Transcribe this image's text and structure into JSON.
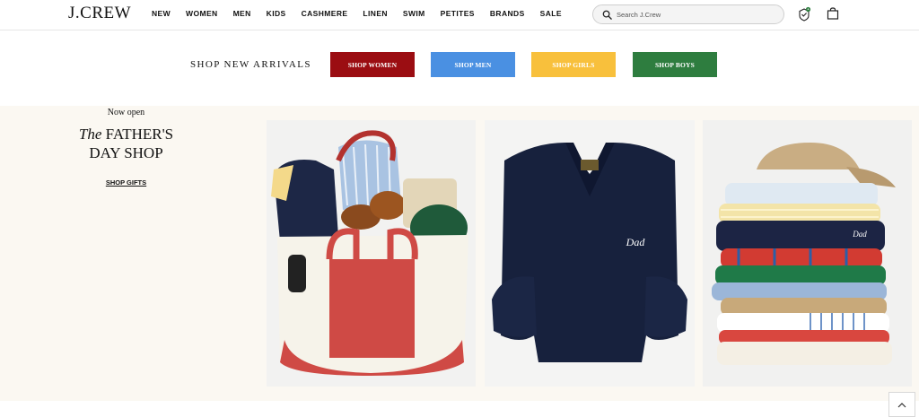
{
  "brand": {
    "logo": "J.CREW"
  },
  "nav": {
    "items": [
      "NEW",
      "WOMEN",
      "MEN",
      "KIDS",
      "CASHMERE",
      "LINEN",
      "SWIM",
      "PETITES",
      "BRANDS",
      "SALE"
    ]
  },
  "search": {
    "placeholder": "Search J.Crew"
  },
  "icons": {
    "rewards": "rewards-badge-icon",
    "bag": "shopping-bag-icon",
    "search": "magnifier-icon",
    "scroll_top": "chevron-up-icon"
  },
  "arrivals": {
    "label": "SHOP NEW ARRIVALS",
    "buttons": [
      {
        "label": "SHOP WOMEN",
        "color": "#9b0d12"
      },
      {
        "label": "SHOP MEN",
        "color": "#4a90e2"
      },
      {
        "label": "SHOP GIRLS",
        "color": "#f8c03c"
      },
      {
        "label": "SHOP BOYS",
        "color": "#2e7d3f"
      }
    ]
  },
  "promo": {
    "eyebrow": "Now open",
    "title_italic": "The",
    "title_line1": "FATHER'S",
    "title_line2": "DAY SHOP",
    "cta": "SHOP GIFTS"
  },
  "colors": {
    "band_bg": "#fbf8f2",
    "rewards_dot": "#2e7d3f"
  }
}
